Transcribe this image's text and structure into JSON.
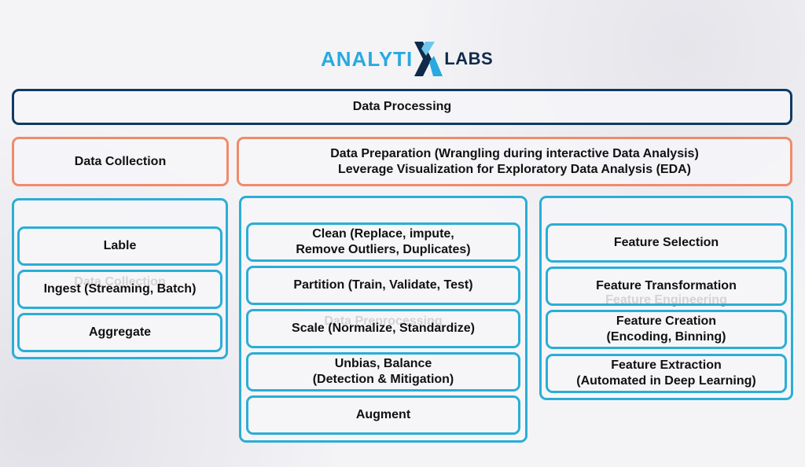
{
  "logo": {
    "part1": "ANALYTI",
    "part2": "LABS",
    "icon": "x-logo-icon"
  },
  "colors": {
    "navy": "#0f3a63",
    "orange": "#f08b6a",
    "blue": "#2aaed6",
    "logo_blue": "#29a9e0"
  },
  "header": {
    "title": "Data Processing"
  },
  "stage_row": {
    "collection": "Data Collection",
    "preparation_line1": "Data Preparation (Wrangling during interactive Data Analysis)",
    "preparation_line2": "Leverage Visualization for Exploratory Data Analysis (EDA)"
  },
  "groups": [
    {
      "title": "Data Collection",
      "items": [
        {
          "line1": "Lable"
        },
        {
          "line1": "Ingest (Streaming, Batch)"
        },
        {
          "line1": "Aggregate"
        }
      ]
    },
    {
      "title": "Data Preprocessing",
      "items": [
        {
          "line1": "Clean (Replace, impute,",
          "line2": "Remove Outliers, Duplicates)"
        },
        {
          "line1": "Partition (Train, Validate, Test)"
        },
        {
          "line1": "Scale (Normalize, Standardize)"
        },
        {
          "line1": "Unbias, Balance",
          "line2": "(Detection & Mitigation)"
        },
        {
          "line1": "Augment"
        }
      ]
    },
    {
      "title": "Feature Engineering",
      "items": [
        {
          "line1": "Feature Selection"
        },
        {
          "line1": "Feature Transformation"
        },
        {
          "line1": "Feature Creation",
          "line2": "(Encoding, Binning)"
        },
        {
          "line1": "Feature Extraction",
          "line2": "(Automated in Deep Learning)"
        }
      ]
    }
  ]
}
